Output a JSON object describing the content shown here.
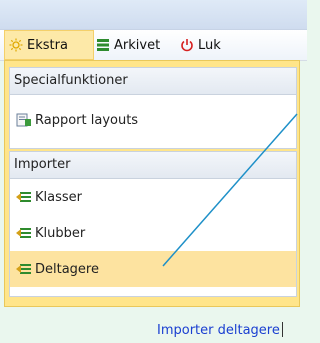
{
  "menu": {
    "items": [
      {
        "label": "Ekstra",
        "icon": "sun-icon"
      },
      {
        "label": "Arkivet",
        "icon": "list-icon"
      },
      {
        "label": "Luk",
        "icon": "power-icon"
      }
    ]
  },
  "dropdown": {
    "special": {
      "header": "Specialfunktioner",
      "items": [
        {
          "label": "Rapport layouts",
          "icon": "report-icon"
        }
      ]
    },
    "import": {
      "header": "Importer",
      "items": [
        {
          "label": "Klasser",
          "icon": "import-icon"
        },
        {
          "label": "Klubber",
          "icon": "import-icon"
        },
        {
          "label": "Deltagere",
          "icon": "import-icon"
        }
      ]
    }
  },
  "status": {
    "text": "Importer deltagere"
  },
  "colors": {
    "accent": "#ffe58a",
    "highlight": "#fde3a0",
    "link": "#1a3fd1",
    "callout_line": "#1e90c8"
  }
}
